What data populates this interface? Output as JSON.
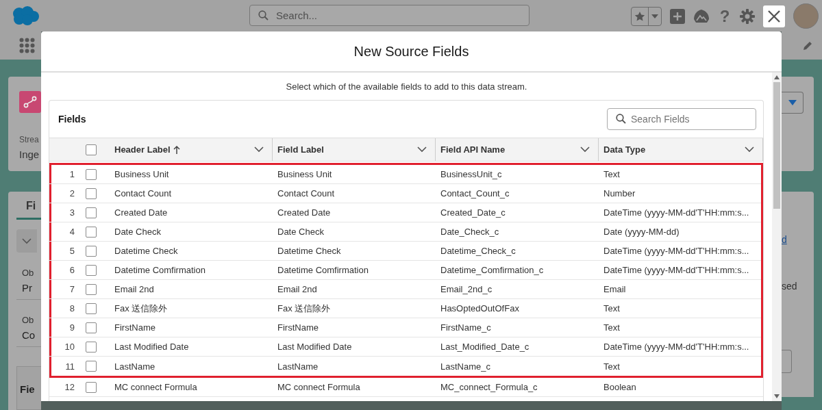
{
  "header": {
    "search": {
      "placeholder": "Search..."
    },
    "help_glyph": "?"
  },
  "background_left": {
    "stream_label": "Strea",
    "stream_value": "Inge",
    "tab": "Fi",
    "object_label_1": "Ob",
    "object_value_1": "Pr",
    "object_label_2": "Ob",
    "object_value_2": "Co",
    "card_title": "Fie"
  },
  "background_right": {
    "link": "d",
    "text": "sed"
  },
  "modal": {
    "title": "New Source Fields",
    "description": "Select which of the available fields to add to this data stream.",
    "card_title": "Fields",
    "search": {
      "placeholder": "Search Fields"
    },
    "table": {
      "select_all": {
        "checked": false
      },
      "columns": [
        {
          "label": "Header Label",
          "sorted": true
        },
        {
          "label": "Field Label",
          "sorted": false
        },
        {
          "label": "Field API Name",
          "sorted": false
        },
        {
          "label": "Data Type",
          "sorted": false
        }
      ],
      "rows": [
        {
          "number": "1",
          "checked": false,
          "highlighted": true,
          "cells": [
            "Business Unit",
            "Business Unit",
            "BusinessUnit_c",
            "Text"
          ]
        },
        {
          "number": "2",
          "checked": false,
          "highlighted": true,
          "cells": [
            "Contact Count",
            "Contact Count",
            "Contact_Count_c",
            "Number"
          ]
        },
        {
          "number": "3",
          "checked": false,
          "highlighted": true,
          "cells": [
            "Created Date",
            "Created Date",
            "Created_Date_c",
            "DateTime (yyyy-MM-dd'T'HH:mm:s..."
          ]
        },
        {
          "number": "4",
          "checked": false,
          "highlighted": true,
          "cells": [
            "Date Check",
            "Date Check",
            "Date_Check_c",
            "Date (yyyy-MM-dd)"
          ]
        },
        {
          "number": "5",
          "checked": false,
          "highlighted": true,
          "cells": [
            "Datetime Check",
            "Datetime Check",
            "Datetime_Check_c",
            "DateTime (yyyy-MM-dd'T'HH:mm:s..."
          ]
        },
        {
          "number": "6",
          "checked": false,
          "highlighted": true,
          "cells": [
            "Datetime Comfirmation",
            "Datetime Comfirmation",
            "Datetime_Comfirmation_c",
            "DateTime (yyyy-MM-dd'T'HH:mm:s..."
          ]
        },
        {
          "number": "7",
          "checked": false,
          "highlighted": true,
          "cells": [
            "Email 2nd",
            "Email 2nd",
            "Email_2nd_c",
            "Email"
          ]
        },
        {
          "number": "8",
          "checked": false,
          "highlighted": true,
          "cells": [
            "Fax 送信除外",
            "Fax 送信除外",
            "HasOptedOutOfFax",
            "Text"
          ]
        },
        {
          "number": "9",
          "checked": false,
          "highlighted": true,
          "cells": [
            "FirstName",
            "FirstName",
            "FirstName_c",
            "Text"
          ]
        },
        {
          "number": "10",
          "checked": false,
          "highlighted": true,
          "cells": [
            "Last Modified Date",
            "Last Modified Date",
            "Last_Modified_Date_c",
            "DateTime (yyyy-MM-dd'T'HH:mm:s..."
          ]
        },
        {
          "number": "11",
          "checked": false,
          "highlighted": true,
          "cells": [
            "LastName",
            "LastName",
            "LastName_c",
            "Text"
          ]
        },
        {
          "number": "12",
          "checked": false,
          "highlighted": false,
          "cells": [
            "MC connect Formula",
            "MC connect Formula",
            "MC_connect_Formula_c",
            "Boolean"
          ]
        }
      ]
    }
  }
}
